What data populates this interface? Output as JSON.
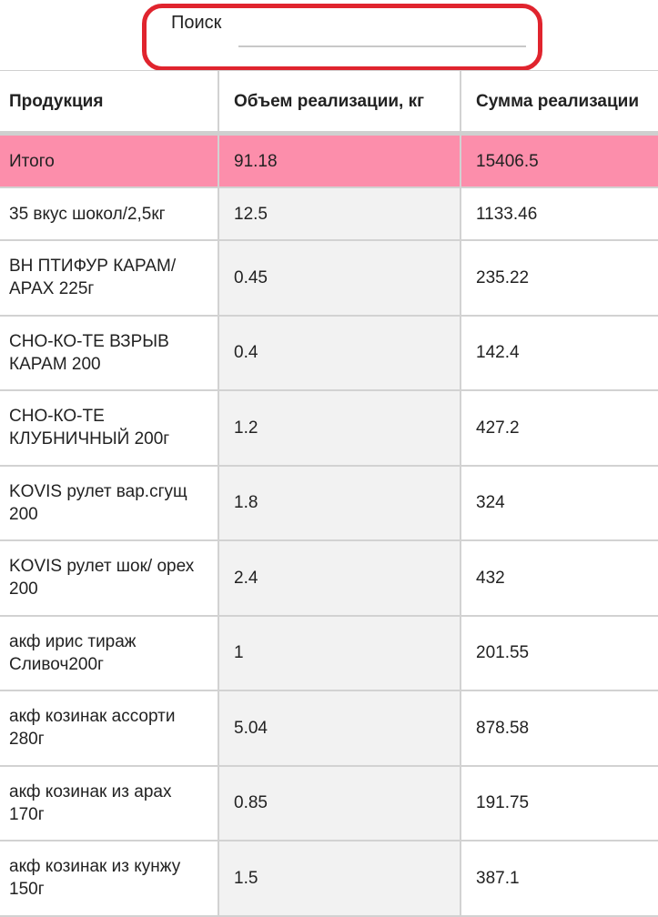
{
  "search": {
    "label": "Поиск",
    "value": "",
    "placeholder": ""
  },
  "columns": [
    "Продукция",
    "Объем реализации, кг",
    "Сумма реализации"
  ],
  "total": {
    "name": "Итого",
    "volume": "91.18",
    "sum": "15406.5"
  },
  "rows": [
    {
      "name": "35 вкус шокол/2,5кг",
      "volume": "12.5",
      "sum": "1133.46"
    },
    {
      "name": "ВН ПТИФУР КАРАМ/ АРАХ 225г",
      "volume": "0.45",
      "sum": "235.22"
    },
    {
      "name": "СНО-КО-ТЕ ВЗРЫВ КАРАМ 200",
      "volume": "0.4",
      "sum": "142.4"
    },
    {
      "name": "СНО-КО-ТЕ КЛУБНИЧНЫЙ 200г",
      "volume": "1.2",
      "sum": "427.2"
    },
    {
      "name": "KOVIS рулет вар.сгущ 200",
      "volume": "1.8",
      "sum": "324"
    },
    {
      "name": "KOVIS рулет шок/ орех 200",
      "volume": "2.4",
      "sum": "432"
    },
    {
      "name": "акф ирис тираж Сливоч200г",
      "volume": "1",
      "sum": "201.55"
    },
    {
      "name": "акф козинак ассорти 280г",
      "volume": "5.04",
      "sum": "878.58"
    },
    {
      "name": "акф козинак из арах 170г",
      "volume": "0.85",
      "sum": "191.75"
    },
    {
      "name": "акф козинак из кунжу 150г",
      "volume": "1.5",
      "sum": "387.1"
    }
  ],
  "colors": {
    "highlight_border": "#e0242e",
    "total_row": "#fc8eab",
    "alt_column": "#f2f2f2"
  }
}
